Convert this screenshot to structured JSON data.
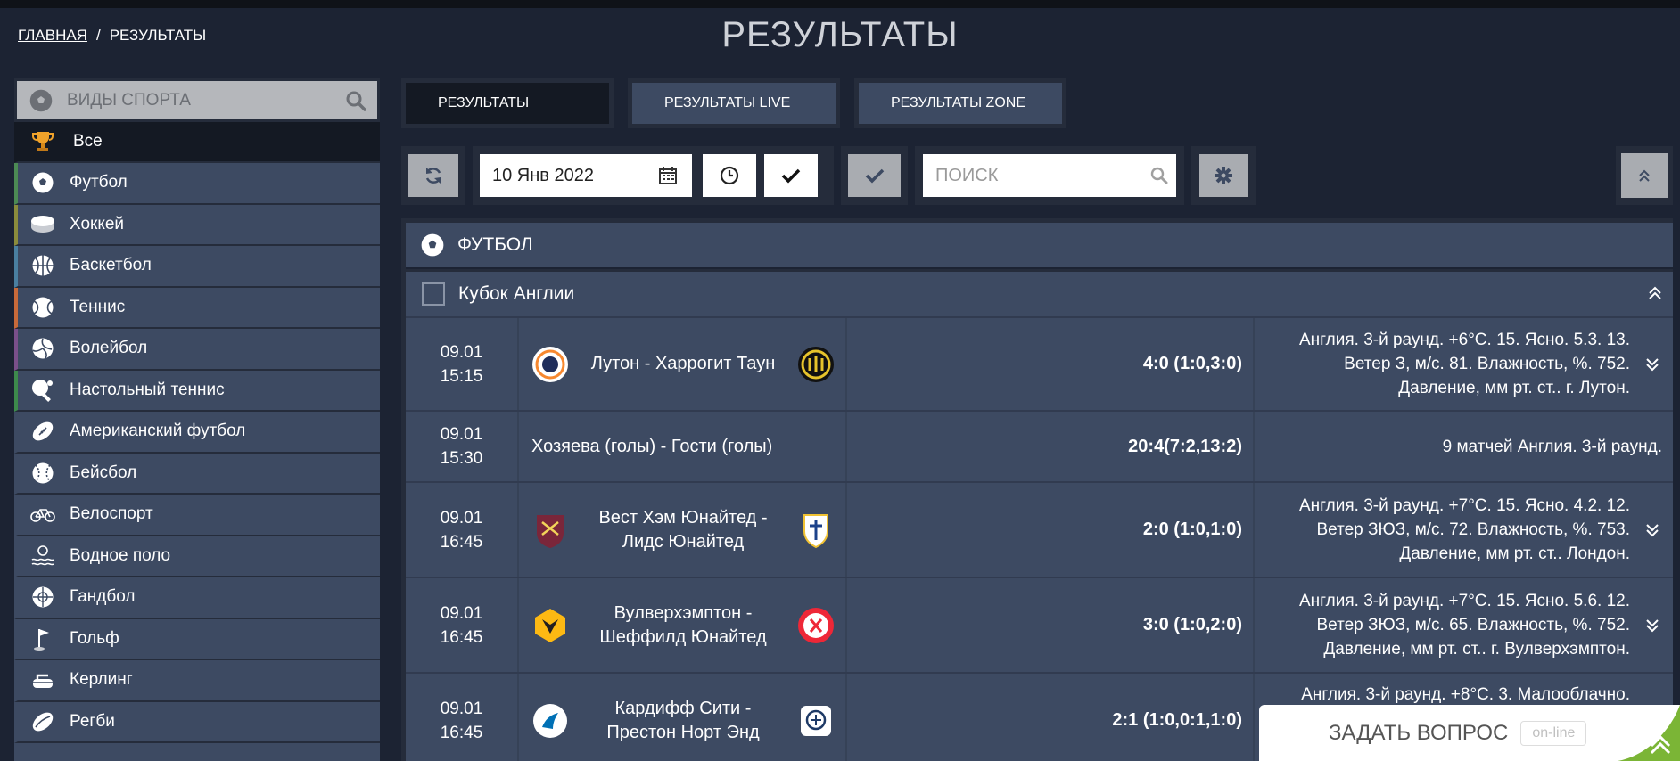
{
  "breadcrumb": {
    "home": "ГЛАВНАЯ",
    "separator": "/",
    "current": "РЕЗУЛЬТАТЫ"
  },
  "page_title": "РЕЗУЛЬТАТЫ",
  "sidebar": {
    "title": "ВИДЫ СПОРТА",
    "items": [
      {
        "label": "Все",
        "icon": "trophy-icon",
        "accent": "#141923"
      },
      {
        "label": "Футбол",
        "icon": "soccer-ball-icon",
        "accent": "#4c8a54"
      },
      {
        "label": "Хоккей",
        "icon": "hockey-puck-icon",
        "accent": "#8a8b3c"
      },
      {
        "label": "Баскетбол",
        "icon": "basketball-icon",
        "accent": "#4a7fa0"
      },
      {
        "label": "Теннис",
        "icon": "tennis-ball-icon",
        "accent": "#c86a3a"
      },
      {
        "label": "Волейбол",
        "icon": "volleyball-icon",
        "accent": "#7a4f8a"
      },
      {
        "label": "Настольный теннис",
        "icon": "table-tennis-icon",
        "accent": "#3d8a4c"
      },
      {
        "label": "Американский футбол",
        "icon": "american-football-icon",
        "accent": "#3d4a62"
      },
      {
        "label": "Бейсбол",
        "icon": "baseball-icon",
        "accent": "#3d4a62"
      },
      {
        "label": "Велоспорт",
        "icon": "bicycle-icon",
        "accent": "#3d4a62"
      },
      {
        "label": "Водное поло",
        "icon": "water-polo-icon",
        "accent": "#3d4a62"
      },
      {
        "label": "Гандбол",
        "icon": "handball-icon",
        "accent": "#3d4a62"
      },
      {
        "label": "Гольф",
        "icon": "golf-flag-icon",
        "accent": "#3d4a62"
      },
      {
        "label": "Керлинг",
        "icon": "curling-stone-icon",
        "accent": "#3d4a62"
      },
      {
        "label": "Регби",
        "icon": "rugby-ball-icon",
        "accent": "#3d4a62"
      }
    ]
  },
  "tabs": [
    {
      "label": "РЕЗУЛЬТАТЫ",
      "active": true
    },
    {
      "label": "РЕЗУЛЬТАТЫ LIVE",
      "active": false
    },
    {
      "label": "РЕЗУЛЬТАТЫ ZONE",
      "active": false
    }
  ],
  "toolbar": {
    "date_value": "10 Янв 2022",
    "search_placeholder": "ПОИСК"
  },
  "results": {
    "sport": "ФУТБОЛ",
    "league": "Кубок Англии",
    "matches": [
      {
        "date": "09.01",
        "time": "15:15",
        "teams": "Лутон - Харрогит Таун",
        "score": "4:0 (1:0,3:0)",
        "info": [
          "Англия. 3-й раунд. +6°C. 15. Ясно. 5.3. 13.",
          "Ветер З, м/с. 81. Влажность, %. 752.",
          "Давление, мм рт. ст.. г. Лутон."
        ]
      },
      {
        "date": "09.01",
        "time": "15:30",
        "teams": "Хозяева (голы) - Гости (голы)",
        "score": "20:4(7:2,13:2)",
        "info": [
          "9 матчей Англия. 3-й раунд."
        ]
      },
      {
        "date": "09.01",
        "time": "16:45",
        "teams": [
          "Вест Хэм Юнайтед -",
          "Лидс Юнайтед"
        ],
        "score": "2:0 (1:0,1:0)",
        "info": [
          "Англия. 3-й раунд. +7°C. 15. Ясно. 4.2. 12.",
          "Ветер ЗЮЗ, м/с. 72. Влажность, %. 753.",
          "Давление, мм рт. ст.. Лондон."
        ]
      },
      {
        "date": "09.01",
        "time": "16:45",
        "teams": [
          "Вулверхэмптон -",
          "Шеффилд Юнайтед"
        ],
        "score": "3:0 (1:0,2:0)",
        "info": [
          "Англия. 3-й раунд. +7°C. 15. Ясно. 5.6. 12.",
          "Ветер ЗЮЗ, м/с. 65. Влажность, %. 752.",
          "Давление, мм рт. ст.. г. Вулверхэмптон."
        ]
      },
      {
        "date": "09.01",
        "time": "16:45",
        "teams": [
          "Кардифф Сити -",
          "Престон Норт Энд"
        ],
        "score": "2:1 (1:0,0:1,1:0)",
        "info": [
          "Англия. 3-й раунд. +8°C. 3. Малооблачно."
        ]
      }
    ]
  },
  "chat": {
    "label": "ЗАДАТЬ ВОПРОС",
    "status": "on-line"
  },
  "colors": {
    "background": "#1c2333",
    "panel": "#3d4a62",
    "dark": "#141923",
    "accent_green": "#7bb536"
  }
}
